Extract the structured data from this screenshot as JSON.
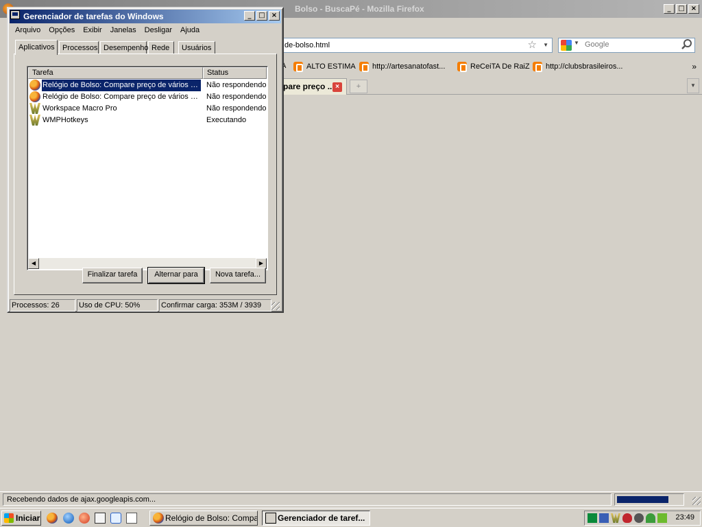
{
  "firefox": {
    "title": "Relógio de Bolso: Compare preço de vários modelos de Relógio de Bolso - BuscaPé - Mozilla Firefox",
    "title_visible": "Bolso - BuscaPé - Mozilla Firefox",
    "url": "de-bolso.html",
    "search_placeholder": "Google",
    "bookmarks": [
      {
        "label": "A"
      },
      {
        "label": "ALTO ESTIMA"
      },
      {
        "label": "http://artesanatofast..."
      },
      {
        "label": "ReCeiTA De RaiZ"
      },
      {
        "label": "http://clubsbrasileiros..."
      }
    ],
    "bookmarks_more": "»",
    "tab_label": "pare preço ...",
    "new_tab": "+",
    "status_text": "Recebendo dados de ajax.googleapis.com...",
    "progress_fraction": 0.8
  },
  "task_manager": {
    "title": "Gerenciador de tarefas do Windows",
    "menu": [
      "Arquivo",
      "Opções",
      "Exibir",
      "Janelas",
      "Desligar",
      "Ajuda"
    ],
    "tabs": [
      "Aplicativos",
      "Processos",
      "Desempenho",
      "Rede",
      "Usuários"
    ],
    "active_tab": "Aplicativos",
    "columns": {
      "task": "Tarefa",
      "status": "Status"
    },
    "rows": [
      {
        "task": "Relógio de Bolso: Compare preço de vários m...",
        "status": "Não respondendo",
        "icon": "firefox-icon",
        "selected": true
      },
      {
        "task": "Relógio de Bolso: Compare preço de vários m...",
        "status": "Não respondendo",
        "icon": "firefox-icon",
        "selected": false
      },
      {
        "task": "Workspace Macro Pro",
        "status": "Não respondendo",
        "icon": "wmp-icon",
        "selected": false
      },
      {
        "task": "WMPHotkeys",
        "status": "Executando",
        "icon": "wmp-icon",
        "selected": false
      }
    ],
    "buttons": {
      "end_task": "Finalizar tarefa",
      "switch_to": "Alternar para",
      "new_task": "Nova tarefa..."
    },
    "status": {
      "processes": "Processos: 26",
      "cpu": "Uso de CPU: 50%",
      "commit": "Confirmar carga: 353M / 3939"
    }
  },
  "taskbar": {
    "start_label": "Iniciar",
    "buttons": [
      {
        "label": "Relógio de Bolso: Compa...",
        "icon": "firefox-icon",
        "active": false
      },
      {
        "label": "Gerenciador de taref...",
        "icon": "task-manager-icon",
        "active": true
      }
    ],
    "clock": "23:49"
  }
}
